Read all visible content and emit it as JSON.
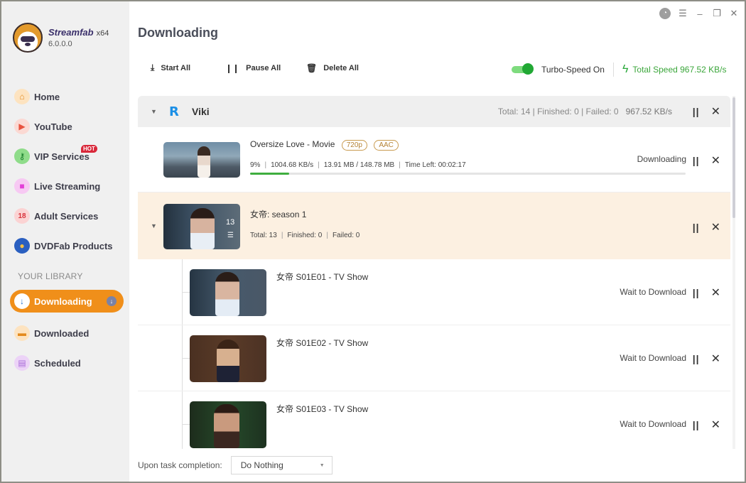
{
  "app": {
    "name": "Streamfab",
    "arch": "x64",
    "version": "6.0.0.0"
  },
  "window_controls": [
    "clock-icon",
    "menu-icon",
    "minimize-icon",
    "restore-icon",
    "close-icon"
  ],
  "sidebar": {
    "items": [
      {
        "label": "Home",
        "icon": "home-icon",
        "color": "#f0a23a"
      },
      {
        "label": "YouTube",
        "icon": "youtube-icon",
        "color": "#e8523e"
      },
      {
        "label": "VIP Services",
        "icon": "key-icon",
        "color": "#2fb14a",
        "badge": "HOT"
      },
      {
        "label": "Live Streaming",
        "icon": "video-camera-icon",
        "color": "#e33fd8"
      },
      {
        "label": "Adult Services",
        "icon": "adult-icon",
        "color": "#e0534e"
      },
      {
        "label": "DVDFab Products",
        "icon": "dvdfab-icon",
        "color": "#2a5fc0"
      }
    ],
    "library_label": "YOUR LIBRARY",
    "library": [
      {
        "label": "Downloading",
        "icon": "download-icon",
        "active": true
      },
      {
        "label": "Downloaded",
        "icon": "folder-icon",
        "color": "#f0a23a"
      },
      {
        "label": "Scheduled",
        "icon": "clipboard-icon",
        "color": "#a86ad8"
      }
    ]
  },
  "main": {
    "title": "Downloading",
    "toolbar": {
      "start_all": "Start All",
      "pause_all": "Pause All",
      "delete_all": "Delete All"
    },
    "turbo": {
      "label": "Turbo-Speed On",
      "enabled": true
    },
    "total_speed": "Total Speed 967.52 KB/s",
    "group": {
      "name": "Viki",
      "stats": "Total: 14  | Finished: 0  | Failed: 0",
      "speed": "967.52 KB/s"
    },
    "movie": {
      "title": "Oversize Love - Movie",
      "tags": [
        "720p",
        "AAC"
      ],
      "percent": "9%",
      "progress": 0.09,
      "speed": "1004.68 KB/s",
      "size": "13.91 MB / 148.78 MB",
      "time_left": "Time Left: 00:02:17",
      "status": "Downloading"
    },
    "season": {
      "title": "女帝: season 1",
      "episode_count": "13",
      "total": "Total: 13",
      "finished": "Finished: 0",
      "failed": "Failed: 0"
    },
    "episodes": [
      {
        "title": "女帝 S01E01 - TV Show",
        "status": "Wait to Download"
      },
      {
        "title": "女帝 S01E02 - TV Show",
        "status": "Wait to Download"
      },
      {
        "title": "女帝 S01E03 - TV Show",
        "status": "Wait to Download"
      }
    ],
    "footer": {
      "label": "Upon task completion:",
      "selected": "Do Nothing"
    }
  }
}
